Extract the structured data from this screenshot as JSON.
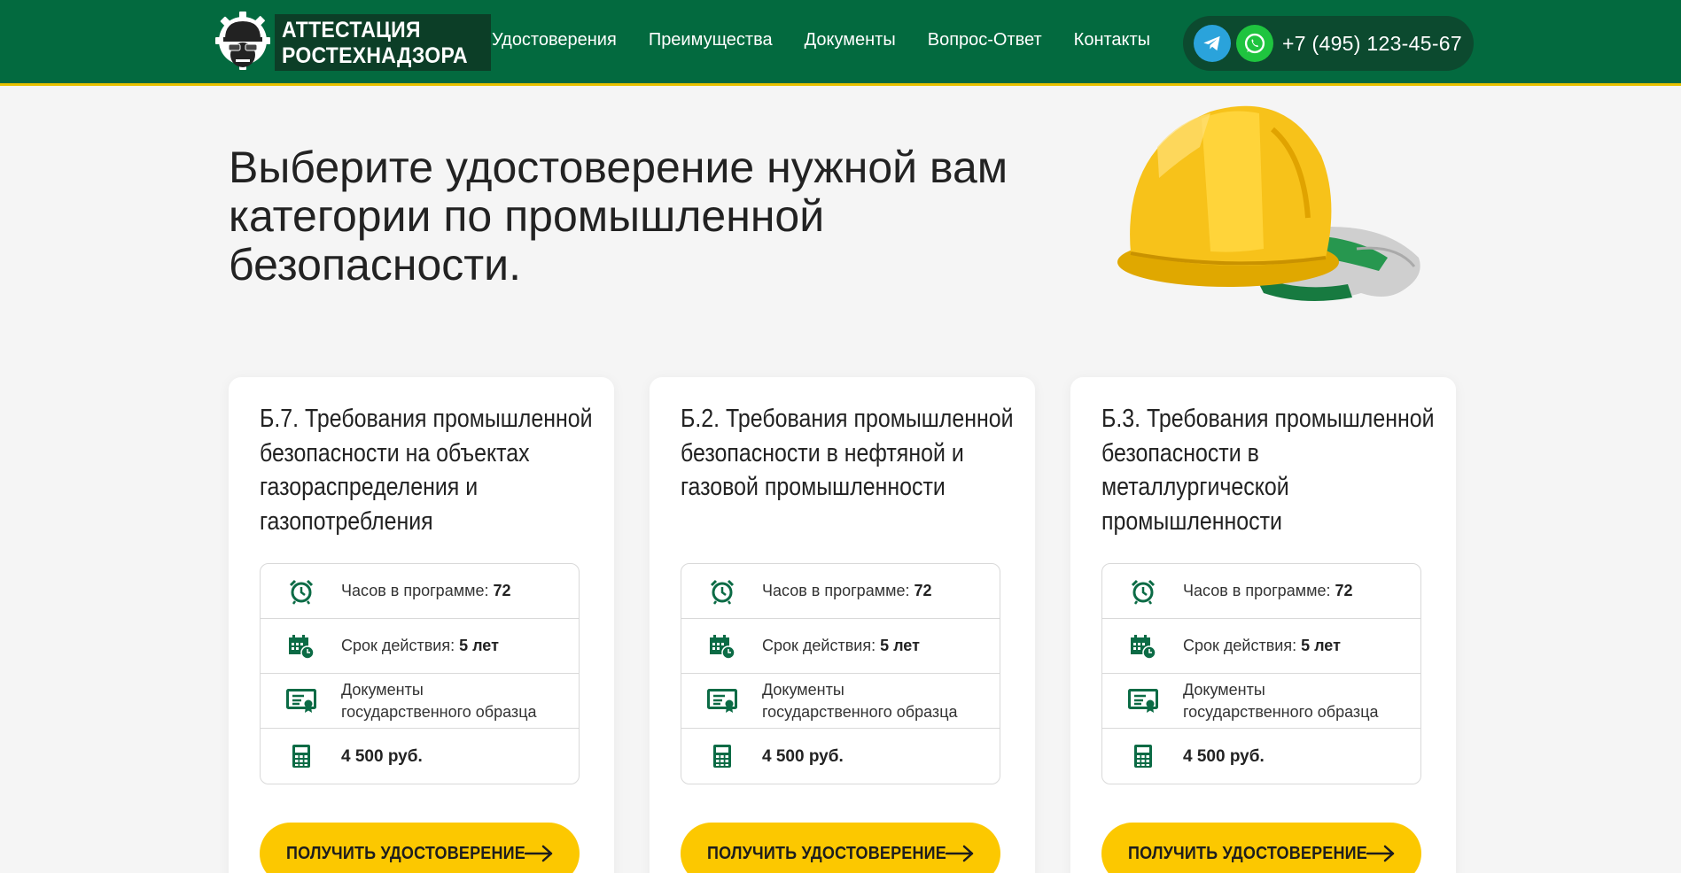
{
  "brand": {
    "line1": "АТТЕСТАЦИЯ",
    "line2": "РОСТЕХНАДЗОРА"
  },
  "nav": [
    "Удостоверения",
    "Преимущества",
    "Документы",
    "Вопрос-Ответ",
    "Контакты"
  ],
  "contact": {
    "phone": "+7 (495) 123-45-67"
  },
  "hero": {
    "title": "Выберите удостоверение нужной вам категории по промышленной безопасности."
  },
  "cards": [
    {
      "title": "Б.7. Требования промышленной безопасности на объектах газораспределения и газопотребления",
      "hours_label": "Часов в программе:",
      "hours_value": "72",
      "validity_label": "Срок действия:",
      "validity_value": "5 лет",
      "docs_line1": "Документы",
      "docs_line2": "государственного образца",
      "price": "4 500 руб.",
      "button": "ПОЛУЧИТЬ УДОСТОВЕРЕНИЕ"
    },
    {
      "title": "Б.2. Требования промышленной безопасности в нефтяной и газовой промышленности",
      "hours_label": "Часов в программе:",
      "hours_value": "72",
      "validity_label": "Срок действия:",
      "validity_value": "5 лет",
      "docs_line1": "Документы",
      "docs_line2": "государственного образца",
      "price": "4 500 руб.",
      "button": "ПОЛУЧИТЬ УДОСТОВЕРЕНИЕ"
    },
    {
      "title": "Б.3. Требования промышленной безопасности в металлургической промышленности",
      "hours_label": "Часов в программе:",
      "hours_value": "72",
      "validity_label": "Срок действия:",
      "validity_value": "5 лет",
      "docs_line1": "Документы",
      "docs_line2": "государственного образца",
      "price": "4 500 руб.",
      "button": "ПОЛУЧИТЬ УДОСТОВЕРЕНИЕ"
    }
  ],
  "icons": {
    "hours": "alarm-clock-icon",
    "validity": "calendar-clock-icon",
    "docs": "certificate-icon",
    "price": "calculator-icon",
    "button_arrow": "arrow-right-icon",
    "telegram": "telegram-icon",
    "whatsapp": "whatsapp-icon"
  },
  "colors": {
    "header": "#036a3f",
    "header_border": "#e9c100",
    "accent_green": "#0b6b45",
    "button": "#fcc800"
  }
}
